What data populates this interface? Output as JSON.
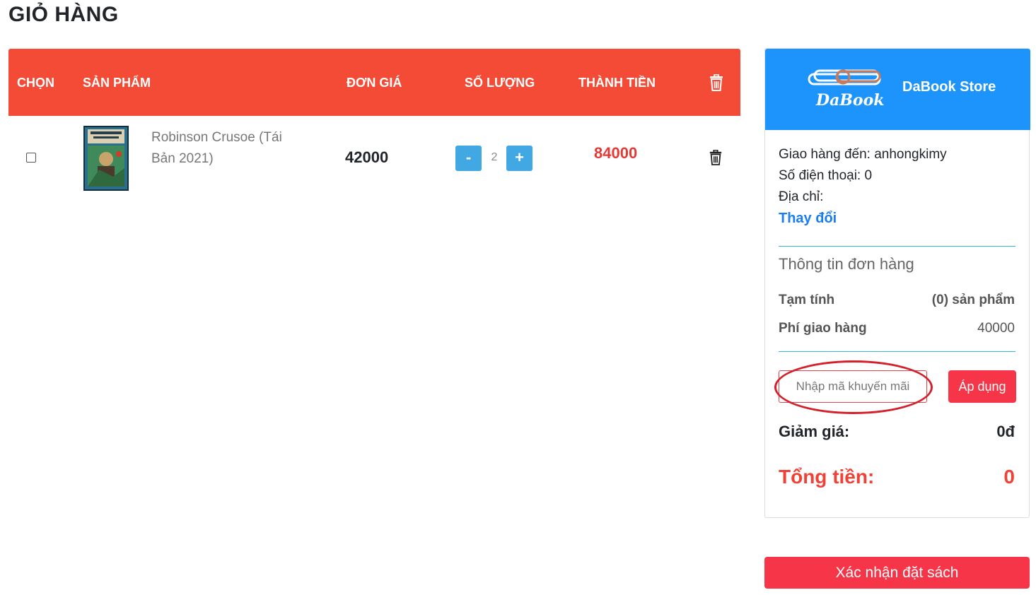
{
  "page": {
    "title": "GIỎ HÀNG"
  },
  "table": {
    "headers": {
      "select": "CHỌN",
      "product": "SẢN PHẨM",
      "price": "ĐƠN GIÁ",
      "quantity": "SỐ LƯỢNG",
      "total": "THÀNH TIỀN",
      "delete_icon": "trash-icon"
    },
    "header_color": "#f44b37",
    "rows": [
      {
        "selected": false,
        "name": "Robinson Crusoe (Tái Bản 2021)",
        "price": "42000",
        "quantity": "2",
        "minus_label": "-",
        "plus_label": "+",
        "total": "84000"
      }
    ]
  },
  "panel": {
    "header_color": "#1c94fb",
    "logo_text": "DaBook",
    "store_name": "DaBook Store",
    "ship_to": "Giao hàng đến: anhongkimy",
    "phone": "Số điện thoại: 0",
    "address": "Địa chỉ:",
    "change_link": "Thay đổi",
    "order_info_title": "Thông tin đơn hàng",
    "subtotal_label": "Tạm tính",
    "subtotal_value": "(0) sản phẩm",
    "shipping_label": "Phí giao hàng",
    "shipping_value": "40000",
    "promo_placeholder": "Nhập mã khuyến mãi",
    "apply_label": "Áp dụng",
    "discount_label": "Giảm giá:",
    "discount_value": "0đ",
    "total_label": "Tổng tiền:",
    "total_value": "0",
    "accent_red": "#f63648"
  },
  "confirm_label": "Xác nhận đặt sách"
}
